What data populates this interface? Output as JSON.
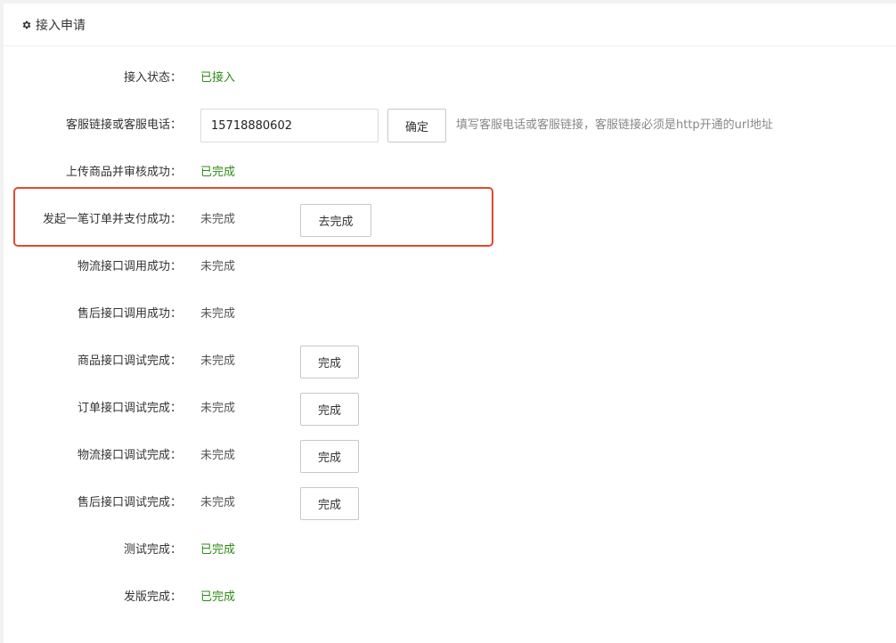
{
  "header": {
    "title": "接入申请",
    "icon": "gear-icon"
  },
  "access_status": {
    "label": "接入状态：",
    "value": "已接入"
  },
  "service_link": {
    "label": "客服链接或客服电话：",
    "input_value": "15718880602",
    "confirm_label": "确定",
    "hint": "填写客服电话或客服链接，客服链接必须是http开通的url地址"
  },
  "steps": [
    {
      "label": "上传商品并审核成功：",
      "status": "已完成"
    },
    {
      "label": "发起一笔订单并支付成功：",
      "status": "未完成",
      "button": "去完成"
    },
    {
      "label": "物流接口调用成功：",
      "status": "未完成"
    },
    {
      "label": "售后接口调用成功：",
      "status": "未完成"
    },
    {
      "label": "商品接口调试完成：",
      "status": "未完成",
      "button": "完成"
    },
    {
      "label": "订单接口调试完成：",
      "status": "未完成",
      "button": "完成"
    },
    {
      "label": "物流接口调试完成：",
      "status": "未完成",
      "button": "完成"
    },
    {
      "label": "售后接口调试完成：",
      "status": "未完成",
      "button": "完成"
    },
    {
      "label": "测试完成：",
      "status": "已完成"
    },
    {
      "label": "发版完成：",
      "status": "已完成"
    }
  ],
  "colors": {
    "done": "#2e8b17",
    "highlight_border": "#e04a2f"
  }
}
